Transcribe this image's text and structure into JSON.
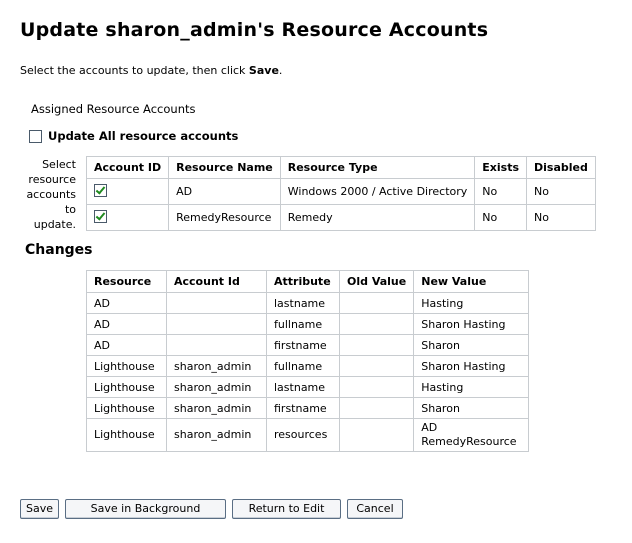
{
  "page_title": "Update sharon_admin's Resource Accounts",
  "instructions": {
    "prefix": "Select the accounts to update, then click ",
    "emphasis": "Save",
    "suffix": "."
  },
  "assigned_label": "Assigned Resource Accounts",
  "update_all": {
    "label": "Update All resource accounts",
    "checked": false
  },
  "select_note": "Select resource accounts to update.",
  "accounts_table": {
    "headers": [
      "Account ID",
      "Resource Name",
      "Resource Type",
      "Exists",
      "Disabled"
    ],
    "rows": [
      {
        "checked": true,
        "resource_name": "AD",
        "resource_type": "Windows 2000 / Active Directory",
        "exists": "No",
        "disabled": "No"
      },
      {
        "checked": true,
        "resource_name": "RemedyResource",
        "resource_type": "Remedy",
        "exists": "No",
        "disabled": "No"
      }
    ]
  },
  "changes_heading": "Changes",
  "changes_table": {
    "headers": [
      "Resource",
      "Account Id",
      "Attribute",
      "Old Value",
      "New Value"
    ],
    "rows": [
      [
        "AD",
        "",
        "lastname",
        "",
        "Hasting"
      ],
      [
        "AD",
        "",
        "fullname",
        "",
        "Sharon Hasting"
      ],
      [
        "AD",
        "",
        "firstname",
        "",
        "Sharon"
      ],
      [
        "Lighthouse",
        "sharon_admin",
        "fullname",
        "",
        "Sharon Hasting"
      ],
      [
        "Lighthouse",
        "sharon_admin",
        "lastname",
        "",
        "Hasting"
      ],
      [
        "Lighthouse",
        "sharon_admin",
        "firstname",
        "",
        "Sharon"
      ],
      [
        "Lighthouse",
        "sharon_admin",
        "resources",
        "",
        "AD RemedyResource"
      ]
    ],
    "last_row_new_value_lines": [
      "AD",
      "RemedyResource"
    ]
  },
  "buttons": {
    "save": "Save",
    "save_background": "Save in Background",
    "return_to_edit": "Return to Edit",
    "cancel": "Cancel"
  },
  "colors": {
    "border": "#c8ccd0",
    "checkmark": "#1f8a1f",
    "button_border": "#5a6e84"
  }
}
